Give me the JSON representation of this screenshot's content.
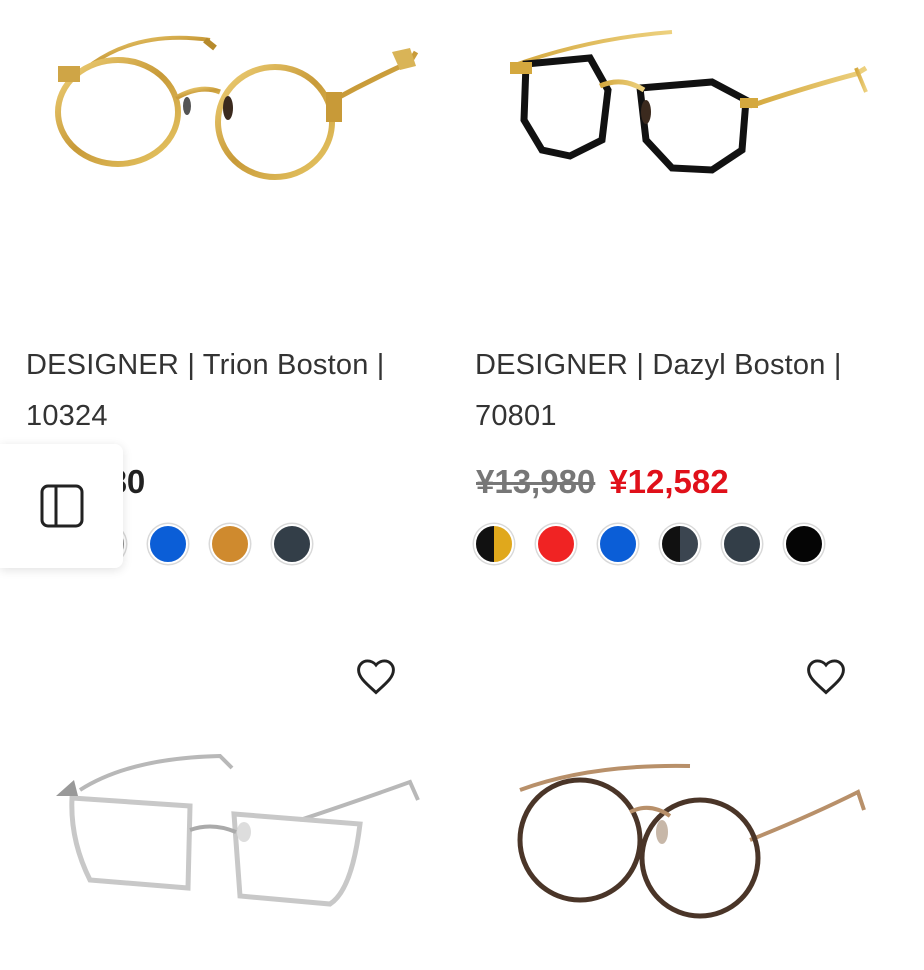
{
  "products": [
    {
      "title": "DESIGNER | Trion Boston | 10324",
      "price": "¥13,980",
      "swatches": [
        "#e8e8e8",
        "#8e8e8e",
        "#0b5ed7",
        "#cf8a2e",
        "#333e48"
      ]
    },
    {
      "title": "DESIGNER | Dazyl Boston | 70801",
      "price_original": "¥13,980",
      "price_sale": "¥12,582",
      "swatches": [
        "black-gold",
        "#f02323",
        "#0b5ed7",
        "black-slate",
        "#333e48",
        "#050505"
      ]
    },
    {
      "wishlist_icon": "heart-outline-icon"
    },
    {
      "wishlist_icon": "heart-outline-icon"
    }
  ],
  "overlay": {
    "panel_icon": "sidebar-panel-icon"
  }
}
